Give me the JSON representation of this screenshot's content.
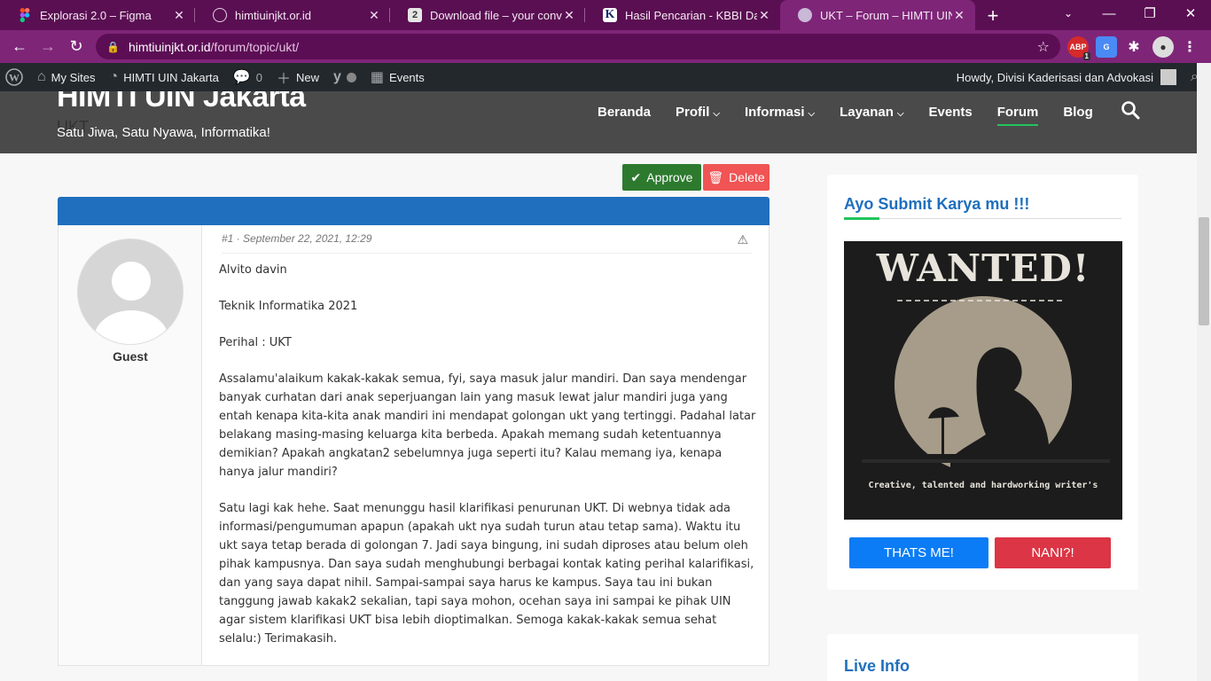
{
  "browser": {
    "tabs": [
      {
        "title": "Explorasi 2.0 – Figma",
        "icon": "figma-icon"
      },
      {
        "title": "himtiuinjkt.or.id",
        "icon": "globe-icon"
      },
      {
        "title": "Download file – your convers",
        "icon": "download-site-icon",
        "badge": "2"
      },
      {
        "title": "Hasil Pencarian - KBBI Daring",
        "icon": "kbbi-icon",
        "badge": "K"
      },
      {
        "title": "UKT – Forum – HIMTI UIN Jak",
        "icon": "site-icon",
        "active": true
      }
    ],
    "url_host": "himtiuinjkt.or.id",
    "url_path": "/forum/topic/ukt/",
    "extensions": {
      "abp_label": "ABP",
      "abp_count": "1"
    },
    "accent": "#7e2578"
  },
  "adminbar": {
    "my_sites": "My Sites",
    "site_name": "HIMTI UIN Jakarta",
    "comments_count": "0",
    "new_label": "New",
    "events_label": "Events",
    "howdy": "Howdy, Divisi Kaderisasi dan Advokasi"
  },
  "header": {
    "site_title": "HIMTI UIN Jakarta",
    "tagline": "Satu Jiwa, Satu Nyawa, Informatika!",
    "page_ghost": "UKT",
    "nav": [
      {
        "label": "Beranda"
      },
      {
        "label": "Profil",
        "dropdown": true
      },
      {
        "label": "Informasi",
        "dropdown": true
      },
      {
        "label": "Layanan",
        "dropdown": true
      },
      {
        "label": "Events"
      },
      {
        "label": "Forum",
        "current": true
      },
      {
        "label": "Blog"
      }
    ]
  },
  "topic": {
    "approve_label": "Approve",
    "delete_label": "Delete",
    "post": {
      "meta": "#1 · September 22, 2021, 12:29",
      "author": "Guest",
      "paragraphs": [
        "Alvito davin",
        "Teknik Informatika 2021",
        "Perihal : UKT",
        "Assalamu'alaikum kakak-kakak semua, fyi, saya masuk jalur mandiri. Dan saya mendengar banyak curhatan dari anak seperjuangan lain yang masuk lewat jalur mandiri juga yang entah kenapa kita-kita anak mandiri ini mendapat golongan ukt yang tertinggi. Padahal latar belakang masing-masing keluarga kita berbeda. Apakah memang sudah ketentuannya demikian? Apakah angkatan2 sebelumnya juga seperti itu? Kalau memang iya, kenapa hanya jalur mandiri?",
        "Satu lagi kak hehe. Saat menunggu hasil klarifikasi penurunan UKT. Di webnya tidak ada informasi/pengumuman apapun (apakah ukt nya sudah turun atau tetap sama). Waktu itu ukt saya tetap berada di golongan 7. Jadi saya bingung, ini sudah diproses atau belum oleh pihak kampusnya. Dan saya sudah menghubungi berbagai kontak kating perihal kalarifikasi, dan yang saya dapat nihil. Sampai-sampai saya harus ke kampus. Saya tau ini bukan tanggung jawab kakak2 sekalian, tapi saya mohon, ocehan saya ini sampai ke pihak UIN agar sistem klarifikasi UKT bisa lebih dioptimalkan. Semoga kakak-kakak semua sehat selalu:) Terimakasih."
      ]
    }
  },
  "sidebar": {
    "widget_title": "Ayo Submit Karya mu !!!",
    "poster_title": "WANTED!",
    "poster_subtitle": "Creative, talented and hardworking writer's",
    "thats_me": "THATS ME!",
    "nani": "NANI?!",
    "live_info_title": "Live Info"
  }
}
